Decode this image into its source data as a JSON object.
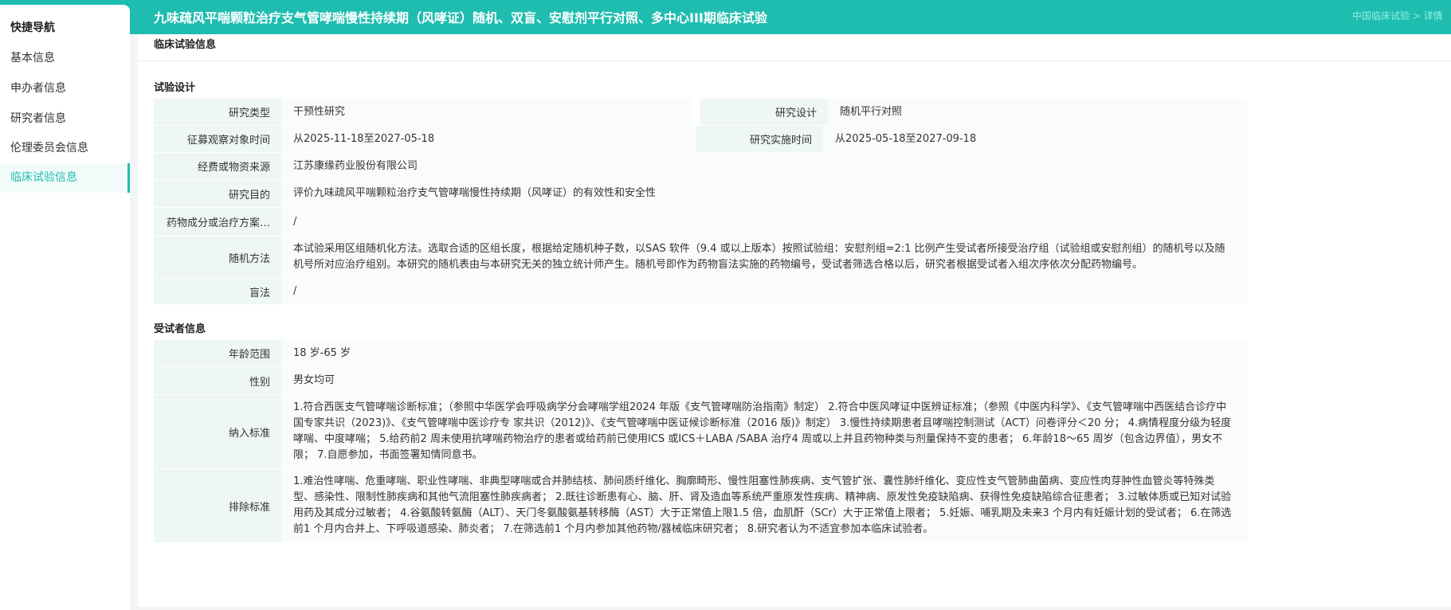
{
  "header": {
    "title": "九味疏风平喘颗粒治疗支气管哮喘慢性持续期（风哮证）随机、双盲、安慰剂平行对照、多中心III期临床试验",
    "breadcrumb": "中国临床试验 > 详情"
  },
  "sidebar": {
    "title": "快捷导航",
    "items": [
      {
        "label": "基本信息"
      },
      {
        "label": "申办者信息"
      },
      {
        "label": "研究者信息"
      },
      {
        "label": "伦理委员会信息"
      },
      {
        "label": "临床试验信息",
        "active": true
      }
    ]
  },
  "accent_color": "#1fbdb0",
  "main": {
    "title": "临床试验信息",
    "design": {
      "section": "试验设计",
      "study_type_label": "研究类型",
      "study_type": "干预性研究",
      "study_design_label": "研究设计",
      "study_design": "随机平行对照",
      "recruit_time_label": "征募观察对象时间",
      "recruit_time": "从2025-11-18至2027-05-18",
      "impl_time_label": "研究实施时间",
      "impl_time": "从2025-05-18至2027-09-18",
      "funding_label": "经费或物资来源",
      "funding": "江苏康缘药业股份有限公司",
      "purpose_label": "研究目的",
      "purpose": "评价九味疏风平喘颗粒治疗支气管哮喘慢性持续期（风哮证）的有效性和安全性",
      "drug_label": "药物成分或治疗方案…",
      "drug": "/",
      "random_label": "随机方法",
      "random": "本试验采用区组随机化方法。选取合适的区组长度，根据给定随机种子数，以SAS 软件（9.4 或以上版本）按照试验组：安慰剂组=2:1 比例产生受试者所接受治疗组（试验组或安慰剂组）的随机号以及随机号所对应治疗组别。本研究的随机表由与本研究无关的独立统计师产生。随机号即作为药物盲法实施的药物编号，受试者筛选合格以后，研究者根据受试者入组次序依次分配药物编号。",
      "blind_label": "盲法",
      "blind": "/"
    },
    "subjects": {
      "section": "受试者信息",
      "age_label": "年龄范围",
      "age": "18 岁-65 岁",
      "sex_label": "性别",
      "sex": "男女均可",
      "inclusion_label": "纳入标准",
      "inclusion": "1.符合西医支气管哮喘诊断标准；（参照中华医学会呼吸病学分会哮喘学组2024 年版《支气管哮喘防治指南》制定） 2.符合中医风哮证中医辨证标准；（参照《中医内科学》、《支气管哮喘中西医结合诊疗中国专家共识（2023)》、《支气管哮喘中医诊疗专 家共识（2012)》、《支气管哮喘中医证候诊断标准（2016 版)》制定） 3.慢性持续期患者且哮喘控制测试（ACT）问卷评分＜20 分； 4.病情程度分级为轻度哮喘、中度哮喘； 5.给药前2 周未使用抗哮喘药物治疗的患者或给药前已使用ICS 或ICS＋LABA /SABA 治疗4 周或以上并且药物种类与剂量保持不变的患者； 6.年龄18～65 周岁（包含边界值），男女不限； 7.自愿参加，书面签署知情同意书。",
      "exclusion_label": "排除标准",
      "exclusion": "1.难治性哮喘、危重哮喘、职业性哮喘、非典型哮喘或合并肺结核、肺间质纤维化、胸廓畸形、慢性阻塞性肺疾病、支气管扩张、囊性肺纤维化、变应性支气管肺曲菌病、变应性肉芽肿性血管炎等特殊类型、感染性、限制性肺疾病和其他气流阻塞性肺疾病者； 2.既往诊断患有心、脑、肝、肾及造血等系统严重原发性疾病、精神病、原发性免疫缺陷病、获得性免疫缺陷综合征患者； 3.过敏体质或已知对试验用药及其成分过敏者； 4.谷氨酸转氨酶（ALT）、天门冬氨酸氨基转移酶（AST）大于正常值上限1.5 倍，血肌酐（SCr）大于正常值上限者； 5.妊娠、哺乳期及未来3 个月内有妊娠计划的受试者； 6.在筛选前1 个月内合并上、下呼吸道感染、肺炎者； 7.在筛选前1 个月内参加其他药物/器械临床研究者； 8.研究者认为不适宜参加本临床试验者。"
    }
  }
}
